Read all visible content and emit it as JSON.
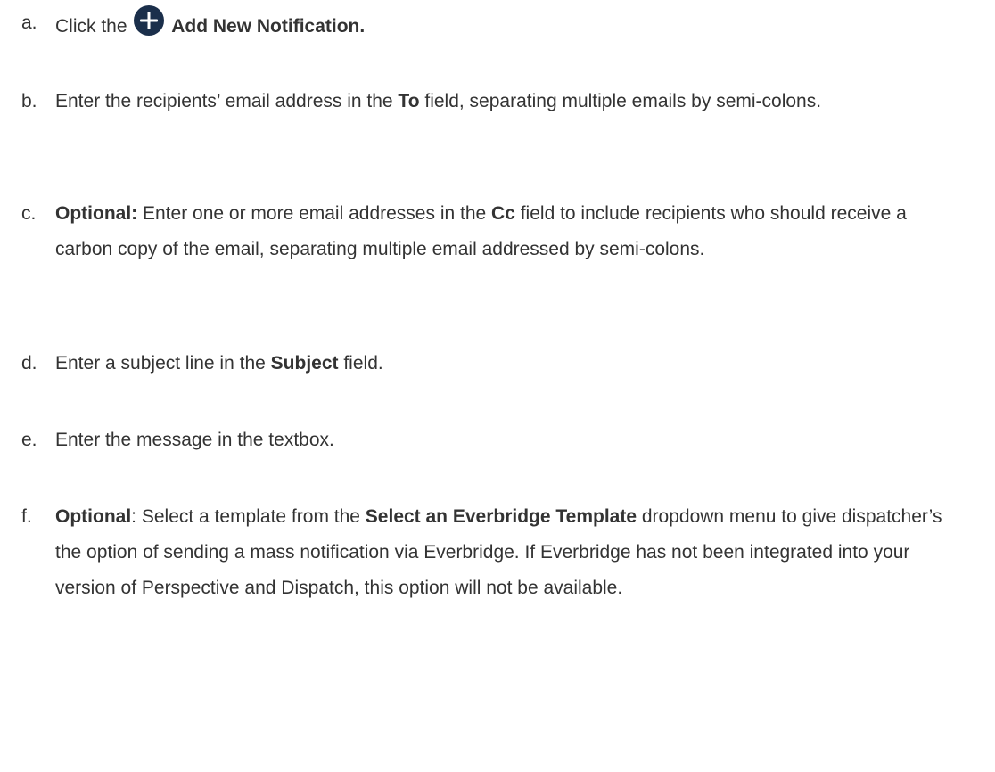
{
  "steps": [
    {
      "marker": "a.",
      "text_before": "Click the",
      "bold": "Add New Notification.",
      "icon": "plus-circle-icon",
      "icon_color": "#1b2f4b"
    },
    {
      "marker": "b.",
      "text_before": "Enter the recipients’ email address in the ",
      "bold": "To",
      "text_after": " field, separating multiple emails by semi-colons."
    },
    {
      "marker": "c.",
      "bold_lead": "Optional:",
      "text_before": " Enter one or more email addresses in the ",
      "bold": "Cc",
      "text_after": " field to include recipients who should receive a carbon copy of the email, separating multiple email addressed by semi-colons."
    },
    {
      "marker": "d.",
      "text_before": "Enter a subject line in the ",
      "bold": "Subject",
      "text_after": " field."
    },
    {
      "marker": "e.",
      "text": "Enter the message in the textbox."
    },
    {
      "marker": "f.",
      "bold_lead": "Optional",
      "text_before": ": Select a template from the ",
      "bold": "Select an Everbridge Template",
      "text_after": " dropdown menu to give dispatcher’s the option of sending a mass notification via Everbridge. If Everbridge has not been integrated into your version of Perspective and Dispatch, this option will not be available."
    }
  ]
}
